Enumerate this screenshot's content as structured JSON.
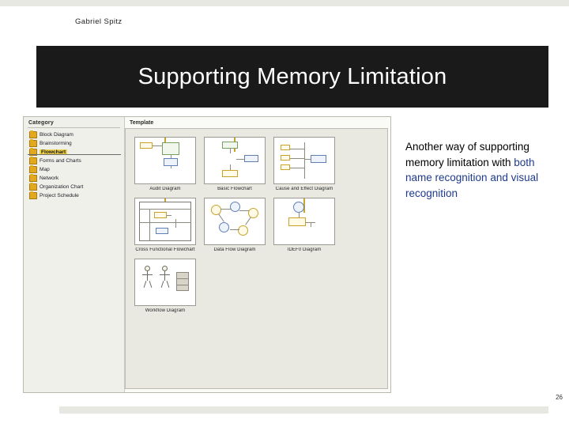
{
  "slide": {
    "author": "Gabriel Spitz",
    "title": "Supporting Memory Limitation",
    "page_number": "26",
    "body": {
      "lead": "Another way of supporting memory limitation with ",
      "highlight": "both name recognition and visual recognition"
    }
  },
  "screenshot": {
    "category_pane": {
      "header": "Category",
      "items": [
        {
          "label": "Block Diagram",
          "selected": false
        },
        {
          "label": "Brainstorming",
          "selected": false
        },
        {
          "label": "Flowchart",
          "selected": true
        },
        {
          "label": "Forms and Charts",
          "selected": false
        },
        {
          "label": "Map",
          "selected": false
        },
        {
          "label": "Network",
          "selected": false
        },
        {
          "label": "Organization Chart",
          "selected": false
        },
        {
          "label": "Project Schedule",
          "selected": false
        }
      ]
    },
    "template_pane": {
      "header": "Template",
      "items": [
        {
          "label": "Audit Diagram",
          "thumb": "audit"
        },
        {
          "label": "Basic Flowchart",
          "thumb": "basic-flowchart"
        },
        {
          "label": "Cause and Effect Diagram",
          "thumb": "cause-effect"
        },
        {
          "label": "Cross Functional Flowchart",
          "thumb": "cross-functional"
        },
        {
          "label": "Data Flow Diagram",
          "thumb": "data-flow"
        },
        {
          "label": "IDEF0 Diagram",
          "thumb": "idef0"
        },
        {
          "label": "Workflow Diagram",
          "thumb": "workflow"
        }
      ]
    }
  },
  "colors": {
    "title_band": "#1a1a1a",
    "title_text": "#ffffff",
    "highlight_text": "#1e3a8f",
    "selection": "#f2d34a",
    "bar": "#e8e8e2"
  }
}
